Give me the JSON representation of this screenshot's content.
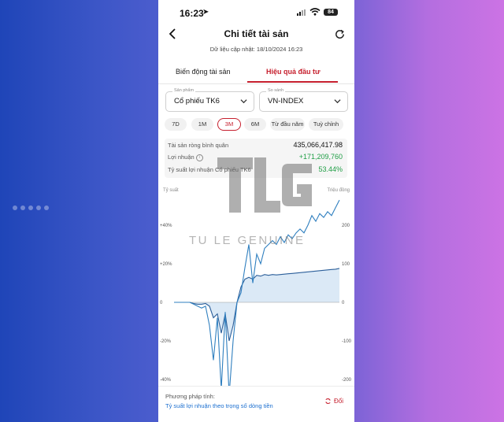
{
  "status_bar": {
    "time": "16:23",
    "battery": "84"
  },
  "header": {
    "title": "Chi tiết tài sản",
    "updated": "Dữ liệu cập nhật: 18/10/2024 16:23"
  },
  "tabs": [
    {
      "label": "Biến động tài sản",
      "active": false
    },
    {
      "label": "Hiệu quả đầu tư",
      "active": true
    }
  ],
  "product_select": {
    "caption": "Sản phẩm",
    "value": "Cổ phiếu TK6"
  },
  "compare_select": {
    "caption": "So sánh",
    "value": "VN-INDEX"
  },
  "periods": [
    {
      "label": "7D"
    },
    {
      "label": "1M"
    },
    {
      "label": "3M",
      "active": true
    },
    {
      "label": "6M"
    },
    {
      "label": "Từ đầu năm"
    },
    {
      "label": "Tuỳ chỉnh"
    }
  ],
  "summary": {
    "avg_nav_label": "Tài sản ròng bình quân",
    "avg_nav_value": "435,066,417.98",
    "profit_label": "Lợi nhuận",
    "profit_value": "+171,209,760",
    "return_label": "Tỷ suất lợi nhuận Cổ phiếu TK6",
    "return_value": "53.44%"
  },
  "chart_data": {
    "type": "line",
    "left_axis_label": "Tỷ suất",
    "right_axis_label": "Triệu đồng",
    "left_ticks": [
      "+40%",
      "+20%",
      "0",
      "-20%",
      "-40%"
    ],
    "right_ticks": [
      "200",
      "100",
      "0",
      "-100",
      "-200"
    ],
    "ylim_left": [
      -40,
      40
    ],
    "ylim_right": [
      -200,
      200
    ],
    "series": [
      {
        "axis": "left",
        "style": "line",
        "values": [
          0,
          0,
          0,
          0,
          0,
          -1,
          -2,
          -3,
          -2,
          -12,
          -30,
          -8,
          -45,
          -5,
          -48,
          -20,
          0,
          5,
          18,
          30,
          10,
          25,
          20,
          28,
          30,
          32,
          30,
          34,
          31,
          35,
          33,
          36,
          38,
          36,
          40,
          45,
          42,
          46,
          44,
          47,
          45,
          49,
          53
        ]
      },
      {
        "axis": "right",
        "style": "area",
        "values": [
          0,
          0,
          0,
          0,
          0,
          -3,
          -5,
          -5,
          -3,
          -10,
          -40,
          -30,
          -80,
          -30,
          -100,
          -60,
          0,
          40,
          60,
          65,
          60,
          70,
          68,
          72,
          70,
          72,
          71,
          72,
          73,
          74,
          75,
          76,
          77,
          78,
          79,
          80,
          81,
          82,
          83,
          84,
          85,
          86,
          88
        ]
      },
      {
        "axis": "right",
        "style": "line",
        "values": [
          0,
          0,
          0,
          0,
          0,
          -3,
          -5,
          -5,
          -3,
          -10,
          -40,
          -30,
          -80,
          -30,
          -100,
          -60,
          0,
          40,
          60,
          65,
          60,
          70,
          68,
          72,
          70,
          72,
          71,
          72,
          73,
          74,
          75,
          76,
          77,
          78,
          79,
          80,
          81,
          82,
          83,
          84,
          85,
          86,
          88
        ]
      }
    ],
    "colors": {
      "return_line": "#2f7fbf",
      "profit_area": "#dbe9f6",
      "profit_line": "#2c5f9a"
    }
  },
  "watermark": {
    "text": "TU LE GENUINE"
  },
  "footer": {
    "method_label": "Phương pháp tính:",
    "method_value": "Tỷ suất lợi nhuận theo trọng số dòng tiền",
    "change_label": "Đổi"
  },
  "colors": {
    "accent": "#c6202e",
    "positive": "#1f9e45",
    "link": "#1a6ecf"
  }
}
